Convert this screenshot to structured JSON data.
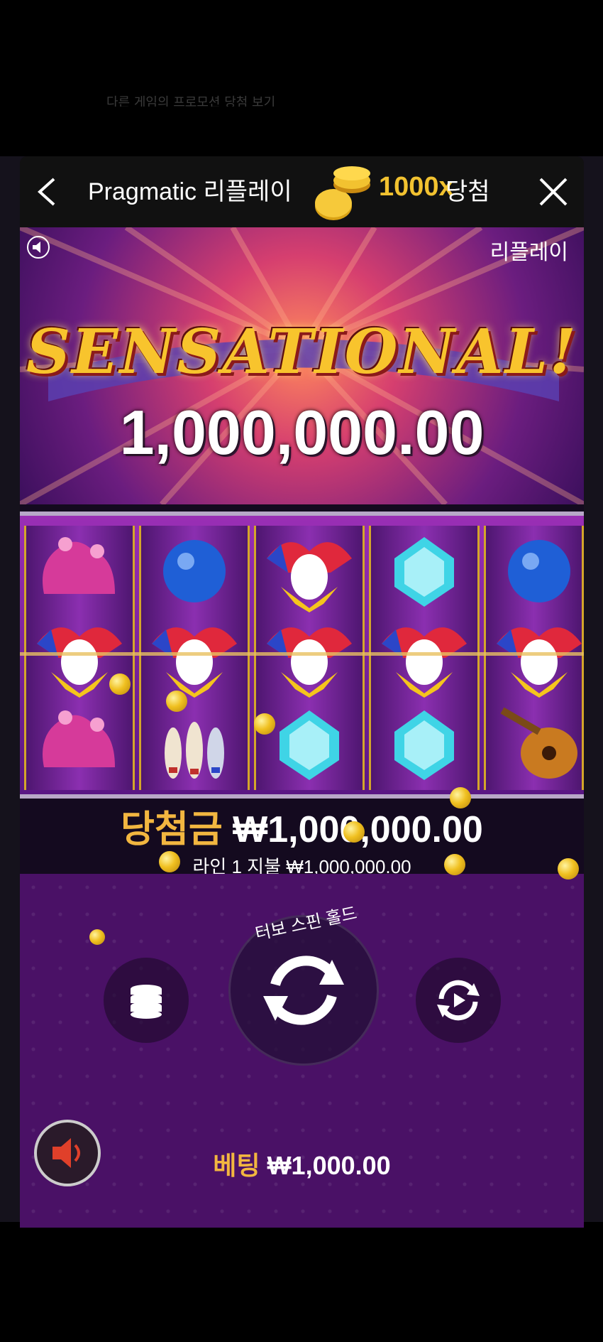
{
  "top_faded_text": "다른 게임의 프로모션 당첨 보기",
  "header": {
    "back_icon": "chevron-left-icon",
    "title": "Pragmatic 리플레이",
    "multiplier": "1000x",
    "win_label": "당첨",
    "close_icon": "close-icon"
  },
  "banner": {
    "replay_label": "리플레이",
    "headline": "SENSATIONAL!",
    "amount": "1,000,000.00"
  },
  "reels": {
    "columns": [
      [
        "jester-hat-icon",
        "joker-mask-icon",
        "jester-hat-icon"
      ],
      [
        "blue-orb-icon",
        "joker-mask-icon",
        "juggling-pins-icon"
      ],
      [
        "joker-mask-icon",
        "joker-mask-icon",
        "diamond-gem-icon"
      ],
      [
        "diamond-gem-icon",
        "joker-mask-icon",
        "diamond-gem-icon"
      ],
      [
        "blue-orb-icon",
        "joker-mask-icon",
        "lute-icon"
      ]
    ]
  },
  "win": {
    "label": "당첨금",
    "amount": "₩1,000,000.00",
    "line_text": "라인 1 지불 ₩1,000,000.00"
  },
  "controls": {
    "turbo_label": "터보 스핀 홀드",
    "bet_label": "베팅",
    "bet_amount": "₩1,000.00"
  },
  "colors": {
    "accent_gold": "#f2b640",
    "panel_bg": "#140a1f",
    "control_bg": "#4a1166"
  }
}
